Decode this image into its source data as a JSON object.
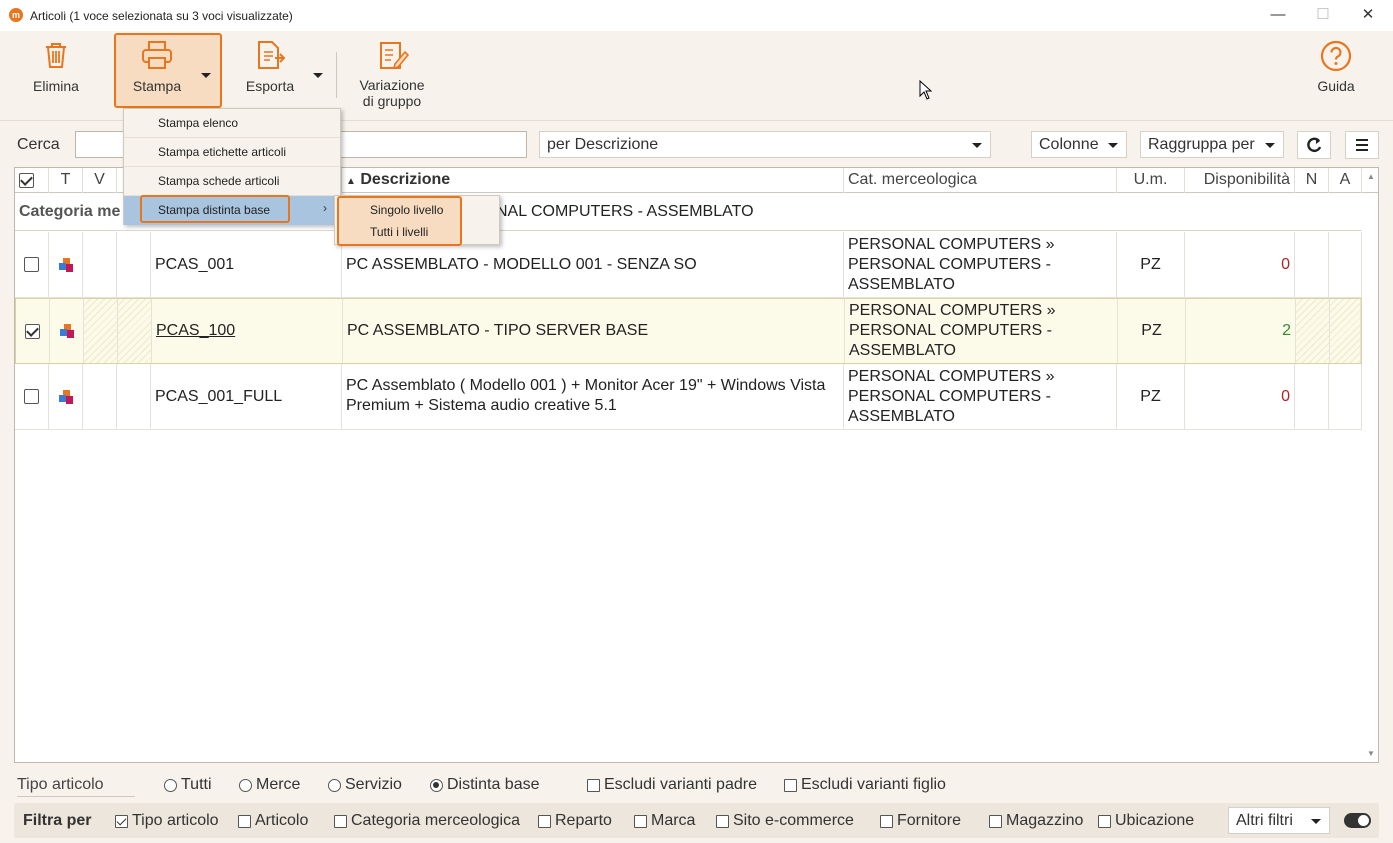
{
  "window": {
    "title": "Articoli (1 voce selezionata su 3 voci visualizzate)",
    "app_icon": "m"
  },
  "toolbar": {
    "elimina": "Elimina",
    "stampa": "Stampa",
    "esporta": "Esporta",
    "variazione_1": "Variazione",
    "variazione_2": "di gruppo",
    "guida": "Guida"
  },
  "search": {
    "label": "Cerca",
    "value": "",
    "field_selector": "per Descrizione",
    "colonne": "Colonne",
    "raggruppa": "Raggruppa per"
  },
  "grid": {
    "headers": {
      "t": "T",
      "v": "V",
      "descrizione": "Descrizione",
      "categoria": "Cat. merceologica",
      "um": "U.m.",
      "disponibilita": "Disponibilità",
      "n": "N",
      "a": "A"
    },
    "group_label": "Categoria merceologica",
    "group_label_visible": "Categoria me",
    "group_value_visible": "NAL COMPUTERS - ASSEMBLATO",
    "rows": [
      {
        "code": "PCAS_001",
        "descr": "PC ASSEMBLATO - MODELLO 001 - SENZA SO",
        "cat1": "PERSONAL COMPUTERS »",
        "cat2": "PERSONAL COMPUTERS -",
        "cat3": "ASSEMBLATO",
        "um": "PZ",
        "disp": "0",
        "checked": false
      },
      {
        "code": "PCAS_100",
        "descr": "PC ASSEMBLATO - TIPO SERVER BASE",
        "cat1": "PERSONAL COMPUTERS »",
        "cat2": "PERSONAL COMPUTERS -",
        "cat3": "ASSEMBLATO",
        "um": "PZ",
        "disp": "2",
        "checked": true
      },
      {
        "code": "PCAS_001_FULL",
        "descr1": "PC Assemblato ( Modello 001 ) + Monitor Acer 19\" + Windows Vista",
        "descr2": "Premium + Sistema audio creative 5.1",
        "cat1": "PERSONAL COMPUTERS »",
        "cat2": "PERSONAL COMPUTERS -",
        "cat3": "ASSEMBLATO",
        "um": "PZ",
        "disp": "0",
        "checked": false
      }
    ]
  },
  "menu": {
    "items": [
      "Stampa elenco",
      "Stampa etichette articoli",
      "Stampa schede articoli",
      "Stampa distinta base"
    ],
    "submenu": [
      "Singolo livello",
      "Tutti i livelli"
    ]
  },
  "filters": {
    "tipo_label": "Tipo articolo",
    "radios": [
      "Tutti",
      "Merce",
      "Servizio",
      "Distinta base"
    ],
    "selected": "Distinta base",
    "escludi_padre": "Escludi varianti padre",
    "escludi_figlio": "Escludi varianti figlio",
    "filtra_per": "Filtra per",
    "checks": [
      "Tipo articolo",
      "Articolo",
      "Categoria merceologica",
      "Reparto",
      "Marca",
      "Sito e-commerce",
      "Fornitore",
      "Magazzino",
      "Ubicazione"
    ],
    "altri_filtri": "Altri filtri"
  },
  "colors": {
    "accent": "#e8761e",
    "highlight": "#f7dcc1",
    "menu_hover": "#a8c4de",
    "zero": "#b22222",
    "positive": "#2e8b2e"
  }
}
